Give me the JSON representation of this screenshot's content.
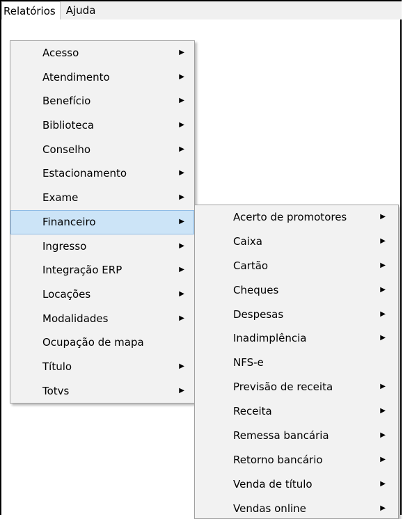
{
  "menubar": {
    "items": [
      {
        "label": "Relatórios",
        "active": true
      },
      {
        "label": "Ajuda",
        "active": false
      }
    ]
  },
  "relatorios_menu": {
    "items": [
      {
        "label": "Acesso",
        "submenu": true
      },
      {
        "label": "Atendimento",
        "submenu": true
      },
      {
        "label": "Benefício",
        "submenu": true
      },
      {
        "label": "Biblioteca",
        "submenu": true
      },
      {
        "label": "Conselho",
        "submenu": true
      },
      {
        "label": "Estacionamento",
        "submenu": true
      },
      {
        "label": "Exame",
        "submenu": true
      },
      {
        "label": "Financeiro",
        "submenu": true,
        "highlighted": true
      },
      {
        "label": "Ingresso",
        "submenu": true
      },
      {
        "label": "Integração ERP",
        "submenu": true
      },
      {
        "label": "Locações",
        "submenu": true
      },
      {
        "label": "Modalidades",
        "submenu": true
      },
      {
        "label": "Ocupação de mapa",
        "submenu": false
      },
      {
        "label": "Título",
        "submenu": true
      },
      {
        "label": "Totvs",
        "submenu": true
      }
    ]
  },
  "financeiro_submenu": {
    "items": [
      {
        "label": "Acerto de promotores",
        "submenu": true
      },
      {
        "label": "Caixa",
        "submenu": true
      },
      {
        "label": "Cartão",
        "submenu": true
      },
      {
        "label": "Cheques",
        "submenu": true
      },
      {
        "label": "Despesas",
        "submenu": true
      },
      {
        "label": "Inadimplência",
        "submenu": true
      },
      {
        "label": "NFS-e",
        "submenu": false
      },
      {
        "label": "Previsão de receita",
        "submenu": true
      },
      {
        "label": "Receita",
        "submenu": true
      },
      {
        "label": "Remessa bancária",
        "submenu": true
      },
      {
        "label": "Retorno bancário",
        "submenu": true
      },
      {
        "label": "Venda de título",
        "submenu": true
      },
      {
        "label": "Vendas online",
        "submenu": true
      }
    ]
  },
  "icons": {
    "submenu_arrow": "▶"
  },
  "colors": {
    "highlight": "#cce4f7",
    "highlight_border": "#8fbce6",
    "menu_bg": "#f2f2f2",
    "menubar_bg": "#f0f0f0"
  }
}
